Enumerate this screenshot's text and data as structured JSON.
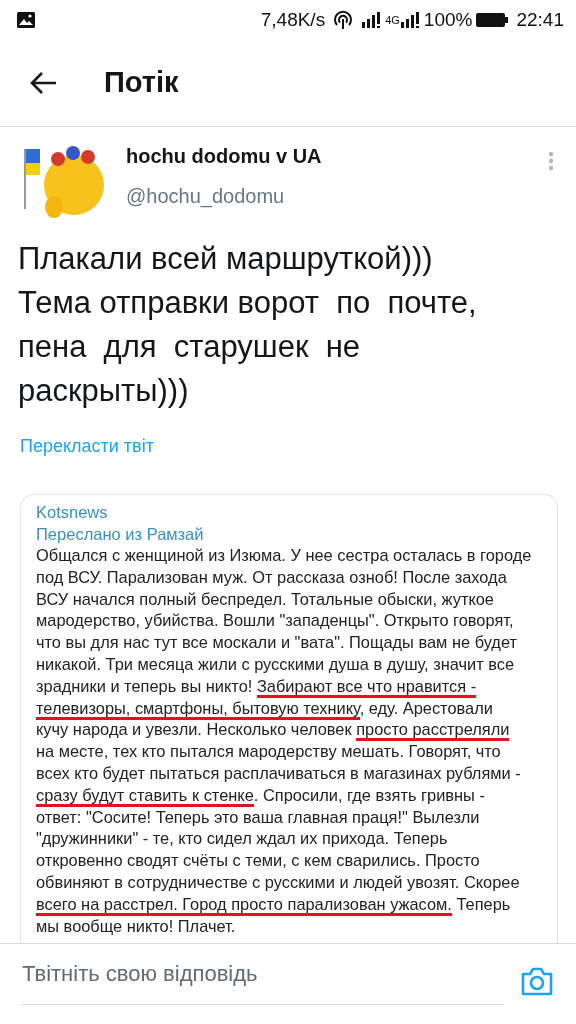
{
  "status_bar": {
    "speed": "7,48K/s",
    "network": "4G",
    "battery": "100%",
    "time": "22:41"
  },
  "header": {
    "title": "Потік"
  },
  "tweet": {
    "name": "hochu dodomu v UA",
    "handle": "@hochu_dodomu",
    "text": "Плакали всей маршруткой)))\nТема отправки ворот  по  почте,\nпена  для  старушек  не\nраскрыты)))",
    "translate": "Перекласти твіт"
  },
  "embedded_message": {
    "channel": "Kotsnews",
    "forwarded": "Переслано из Рамзай",
    "lines": [
      [
        {
          "text": "Общался с женщиной из Изюма. У нее сестра осталась в городе",
          "underlined": false
        }
      ],
      [
        {
          "text": "под ВСУ. Парализован муж. От рассказа озноб! После захода",
          "underlined": false
        }
      ],
      [
        {
          "text": "ВСУ начался полный беспредел. Тотальные обыски, жуткое",
          "underlined": false
        }
      ],
      [
        {
          "text": "мародерство, убийства. Вошли \"западенцы\". Открыто говорят,",
          "underlined": false
        }
      ],
      [
        {
          "text": "что вы для нас тут все москали и \"вата\". Пощады вам не будет",
          "underlined": false
        }
      ],
      [
        {
          "text": "никакой. Три месяца жили с русскими душа в душу, значит все",
          "underlined": false
        }
      ],
      [
        {
          "text": "зрадники и теперь вы никто! ",
          "underlined": false
        },
        {
          "text": "Забирают все что нравится -",
          "underlined": true
        }
      ],
      [
        {
          "text": "телевизоры, смартфоны, бытовую технику",
          "underlined": true
        },
        {
          "text": ", еду. Арестовали",
          "underlined": false
        }
      ],
      [
        {
          "text": "кучу народа и увезли. Несколько человек ",
          "underlined": false
        },
        {
          "text": "просто расстреляли",
          "underlined": true
        }
      ],
      [
        {
          "text": "на месте, тех кто пытался мародерству мешать. Говорят, что",
          "underlined": false
        }
      ],
      [
        {
          "text": "всех кто будет пытаться расплачиваться в магазинах рублями -",
          "underlined": false
        }
      ],
      [
        {
          "text": "сразу будут ставить к стенке",
          "underlined": true
        },
        {
          "text": ". Спросили, где взять гривны -",
          "underlined": false
        }
      ],
      [
        {
          "text": "ответ: \"Сосите! Теперь это ваша главная праця!\" Вылезли",
          "underlined": false
        }
      ],
      [
        {
          "text": "\"дружинники\" - те, кто сидел ждал их прихода. Теперь",
          "underlined": false
        }
      ],
      [
        {
          "text": "откровенно сводят счёты с теми, с кем сварились. Просто",
          "underlined": false
        }
      ],
      [
        {
          "text": "обвиняют в сотрудничестве с русскими и людей увозят. Скорее",
          "underlined": false
        }
      ],
      [
        {
          "text": "всего на расстрел. Город просто парализован ужасом.",
          "underlined": true
        },
        {
          "text": " Теперь",
          "underlined": false
        }
      ],
      [
        {
          "text": "мы вообще никто! Плачет.",
          "underlined": false
        }
      ]
    ]
  },
  "reply": {
    "placeholder": "Твітніть свою відповідь"
  }
}
